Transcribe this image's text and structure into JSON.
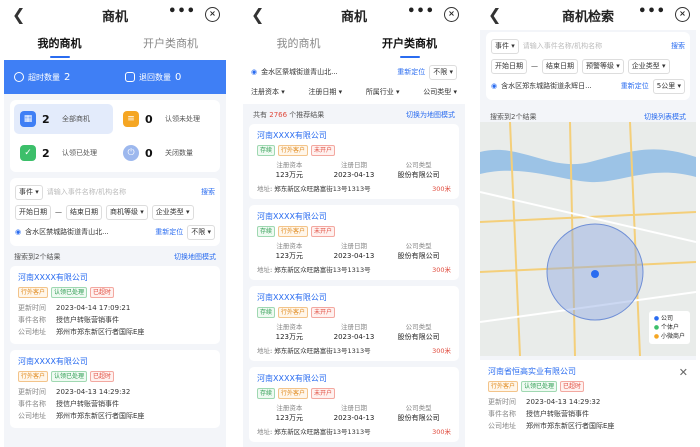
{
  "s1": {
    "title": "商机",
    "tabs": [
      "我的商机",
      "开户类商机"
    ],
    "blue": [
      {
        "label": "超时数量",
        "num": "2"
      },
      {
        "label": "退回数量",
        "num": "0"
      }
    ],
    "stats": [
      {
        "num": "2",
        "label": "全部商机"
      },
      {
        "num": "0",
        "label": "认领未处理"
      },
      {
        "num": "2",
        "label": "认领已处理"
      },
      {
        "num": "0",
        "label": "关闭数量"
      }
    ],
    "event_label": "事件",
    "event_ph": "请输入事件名称/机构名称",
    "search": "搜索",
    "start": "开始日期",
    "dash": "—",
    "end": "结束日期",
    "level": "商机等级",
    "type": "企业类型",
    "location": "含水区禁城路街道青山北...",
    "relocate": "重新定位",
    "unlimited": "不限",
    "count": "搜索到2个结果",
    "switch": "切换地图模式",
    "cards": [
      {
        "name": "河南XXXX有限公司",
        "tags": [
          "行外客户",
          "认领已处理",
          "已超时"
        ],
        "time_k": "更新时间",
        "time": "2023-04-14 17:09:21",
        "ev_k": "事件名称",
        "ev": "授信户转账营销事件",
        "ad_k": "公司地址",
        "ad": "郑州市郑东新区行者国际E座"
      },
      {
        "name": "河南XXXX有限公司",
        "tags": [
          "行外客户",
          "认领已处理",
          "已超时"
        ],
        "time_k": "更新时间",
        "time": "2023-04-13 14:29:32",
        "ev_k": "事件名称",
        "ev": "授信户转账营销事件",
        "ad_k": "公司地址",
        "ad": "郑州市郑东新区行者国际E座"
      }
    ]
  },
  "s2": {
    "title": "商机",
    "tabs": [
      "我的商机",
      "开户类商机"
    ],
    "location": "金水区祭城街道青山北...",
    "relocate": "重新定位",
    "unlimited": "不限",
    "filters": [
      "注册资本",
      "注册日期",
      "所属行业",
      "公司类型"
    ],
    "count_pre": "共有",
    "count_num": "2766",
    "count_post": "个推荐结果",
    "switch": "切换为地图模式",
    "cards": [
      {
        "name": "河南XXXX有限公司",
        "tags": [
          "存续",
          "行外客户",
          "未开户"
        ],
        "h": [
          "注册资本",
          "注册日期",
          "公司类型"
        ],
        "v": [
          "123万元",
          "2023-04-13",
          "股份有限公司"
        ],
        "addr_k": "地址",
        "addr": "郑东新区众旺路富街13号1313号",
        "dist": "300米"
      },
      {
        "name": "河南XXXX有限公司",
        "tags": [
          "存续",
          "行外客户",
          "未开户"
        ],
        "h": [
          "注册资本",
          "注册日期",
          "公司类型"
        ],
        "v": [
          "123万元",
          "2023-04-13",
          "股份有限公司"
        ],
        "addr_k": "地址",
        "addr": "郑东新区众旺路富街13号1313号",
        "dist": "300米"
      },
      {
        "name": "河南XXXX有限公司",
        "tags": [
          "存续",
          "行外客户",
          "未开户"
        ],
        "h": [
          "注册资本",
          "注册日期",
          "公司类型"
        ],
        "v": [
          "123万元",
          "2023-04-13",
          "股份有限公司"
        ],
        "addr_k": "地址",
        "addr": "郑东新区众旺路富街13号1313号",
        "dist": "300米"
      },
      {
        "name": "河南XXXX有限公司",
        "tags": [
          "存续",
          "行外客户",
          "未开户"
        ],
        "h": [
          "注册资本",
          "注册日期",
          "公司类型"
        ],
        "v": [
          "123万元",
          "2023-04-13",
          "股份有限公司"
        ],
        "addr_k": "地址",
        "addr": "郑东新区众旺路富街13号1313号",
        "dist": "300米"
      }
    ]
  },
  "s3": {
    "title": "商机检索",
    "event_label": "事件",
    "event_ph": "请输入事件名称/机构名称",
    "search": "搜索",
    "start": "开始日期",
    "dash": "—",
    "end": "结束日期",
    "level": "预警等级",
    "type": "企业类型",
    "location": "含水区郑东城路街道永辉日...",
    "relocate": "重新定位",
    "radius": "5公里",
    "count": "搜索到2个结果",
    "switch": "切换列表模式",
    "legend": [
      "公司",
      "个体户",
      "小微商户"
    ],
    "popup": {
      "name": "河南省恒高实业有限公司",
      "tags": [
        "行外客户",
        "认领已处理",
        "已超时"
      ],
      "time_k": "更新时间",
      "time": "2023-04-13 14:29:32",
      "ev_k": "事件名称",
      "ev": "授信户转账营销事件",
      "ad_k": "公司地址",
      "ad": "郑州市郑东新区行者国际E座"
    }
  },
  "colors": {
    "accent": "#2a6cf0",
    "blue": "#3f7ff5"
  }
}
